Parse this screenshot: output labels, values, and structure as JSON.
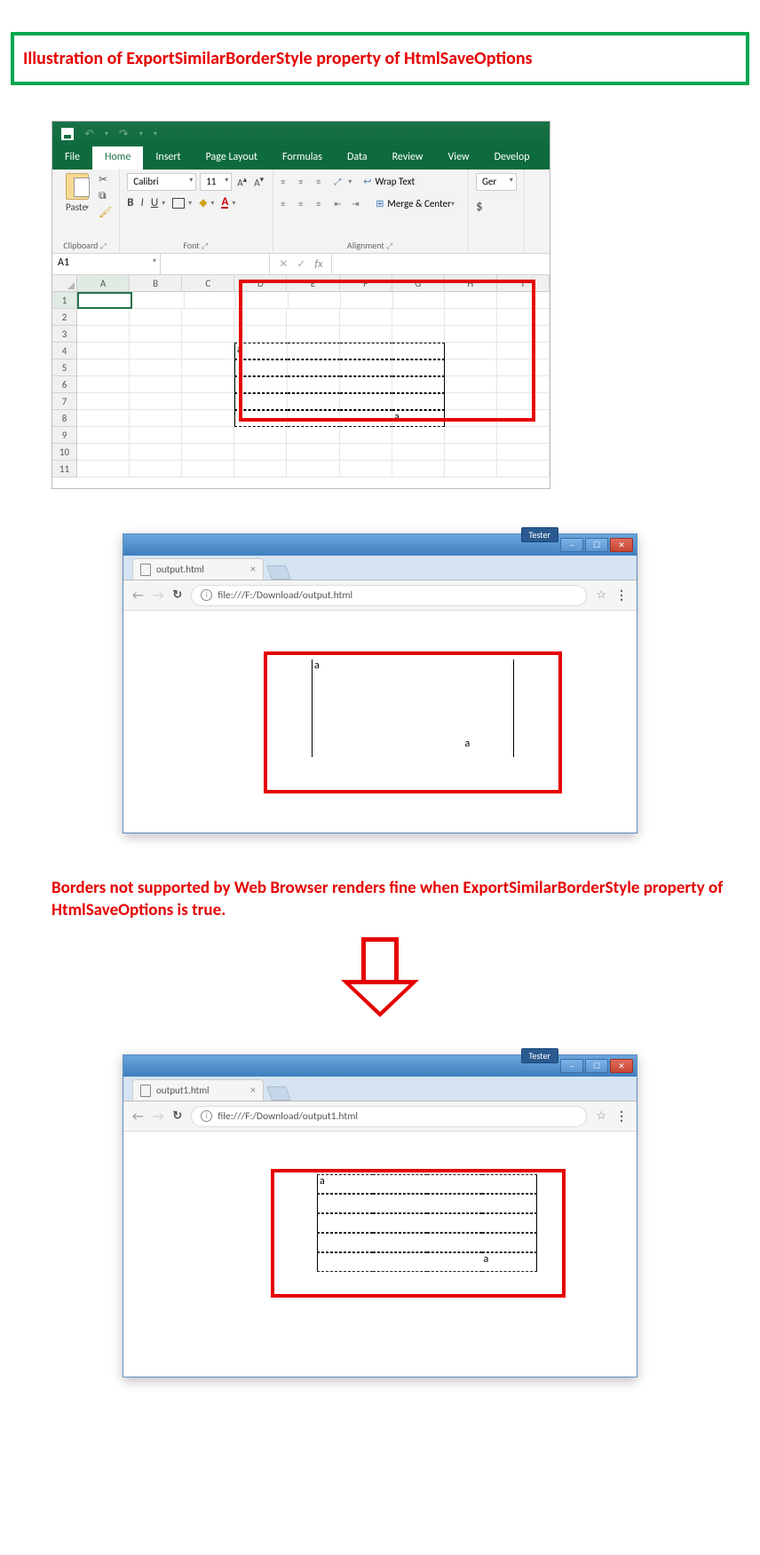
{
  "title": "Illustration of ExportSimilarBorderStyle property of HtmlSaveOptions",
  "description": "Borders not supported by Web Browser renders fine when ExportSimilarBorderStyle property of HtmlSaveOptions is true.",
  "excel": {
    "tabs": {
      "file": "File",
      "home": "Home",
      "insert": "Insert",
      "page_layout": "Page Layout",
      "formulas": "Formulas",
      "data": "Data",
      "review": "Review",
      "view": "View",
      "developer": "Develop"
    },
    "ribbon": {
      "paste": "Paste",
      "clipboard": "Clipboard",
      "font_name": "Calibri",
      "font_size": "11",
      "font_grp": "Font",
      "alignment": "Alignment",
      "wrap": "Wrap Text",
      "merge": "Merge & Center",
      "number_fmt": "Ger",
      "dollar": "$"
    },
    "namebox": "A1",
    "fx": "fx",
    "cols": [
      "A",
      "B",
      "C",
      "D",
      "E",
      "F",
      "G",
      "H",
      "I"
    ],
    "rows": [
      "1",
      "2",
      "3",
      "4",
      "5",
      "6",
      "7",
      "8",
      "9",
      "10",
      "11"
    ],
    "vals": {
      "d4": "a",
      "g8": "a"
    }
  },
  "browser1": {
    "tab_title": "output.html",
    "url": "file:///F:/Download/output.html",
    "tester": "Tester",
    "vals": {
      "a1": "a",
      "a5": "a"
    }
  },
  "browser2": {
    "tab_title": "output1.html",
    "url": "file:///F:/Download/output1.html",
    "tester": "Tester",
    "vals": {
      "a1": "a",
      "a5": "a"
    }
  }
}
